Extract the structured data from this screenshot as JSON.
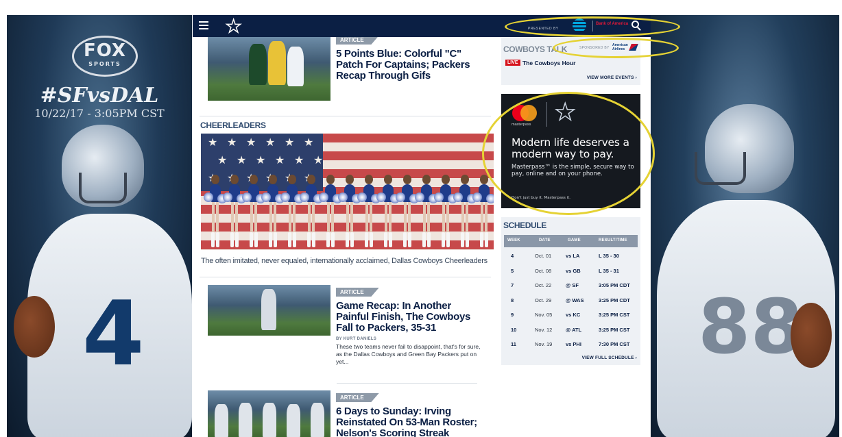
{
  "skin_left": {
    "logo_word": "FOX",
    "logo_sub": "SPORTS",
    "matchup": "#SFvsDAL",
    "game_date": "10/22/17 - 3:05PM CST",
    "jersey_number": "4"
  },
  "skin_right": {
    "jersey_number": "88"
  },
  "nav": {
    "presented_by": "PRESENTED BY",
    "sponsor_b": "Bank of America"
  },
  "stories": [
    {
      "badge": "ARTICLE",
      "headline": "5 Points Blue: Colorful \"C\" Patch For Captains; Packers Recap Through Gifs"
    },
    {
      "badge": "ARTICLE",
      "headline": "Game Recap: In Another Painful Finish, The Cowboys Fall to Packers, 35-31",
      "byline": "BY KURT DANIELS",
      "teaser": "These two teams never fail to disappoint, that's for sure, as the Dallas Cowboys and Green Bay Packers put on yet..."
    },
    {
      "badge": "ARTICLE",
      "headline": "6 Days to Sunday: Irving Reinstated On 53-Man Roster; Nelson's Scoring Streak"
    }
  ],
  "cheerleaders": {
    "section_title": "CHEERLEADERS",
    "caption": "The often imitated, never equaled, internationally acclaimed, Dallas Cowboys Cheerleaders"
  },
  "talk": {
    "title": "COWBOYS TALK",
    "sponsored_by": "SPONSORED BY",
    "sponsor": "American Airlines",
    "live_label": "LIVE",
    "live_show": "The Cowboys Hour",
    "view_more": "VIEW MORE EVENTS ›"
  },
  "ad": {
    "brand": "masterpass",
    "headline": "Modern life deserves a modern way to pay.",
    "body": "Masterpass™ is the simple, secure way to pay, online and on your phone.",
    "tagline": "Don't just buy it. Masterpass it."
  },
  "schedule": {
    "title": "SCHEDULE",
    "columns": [
      "WEEK",
      "DATE",
      "GAME",
      "RESULT/TIME"
    ],
    "rows": [
      {
        "week": "4",
        "date": "Oct. 01",
        "game": "vs LA",
        "result": "L 35 - 30"
      },
      {
        "week": "5",
        "date": "Oct. 08",
        "game": "vs GB",
        "result": "L 35 - 31"
      },
      {
        "week": "7",
        "date": "Oct. 22",
        "game": "@ SF",
        "result": "3:05 PM CDT"
      },
      {
        "week": "8",
        "date": "Oct. 29",
        "game": "@ WAS",
        "result": "3:25 PM CDT"
      },
      {
        "week": "9",
        "date": "Nov. 05",
        "game": "vs KC",
        "result": "3:25 PM CST"
      },
      {
        "week": "10",
        "date": "Nov. 12",
        "game": "@ ATL",
        "result": "3:25 PM CST"
      },
      {
        "week": "11",
        "date": "Nov. 19",
        "game": "vs PHI",
        "result": "7:30 PM CST"
      }
    ],
    "view_full": "VIEW FULL SCHEDULE ›"
  },
  "colors": {
    "navy": "#0b1f44",
    "highlight": "#e5d234",
    "live_red": "#d6141d"
  }
}
